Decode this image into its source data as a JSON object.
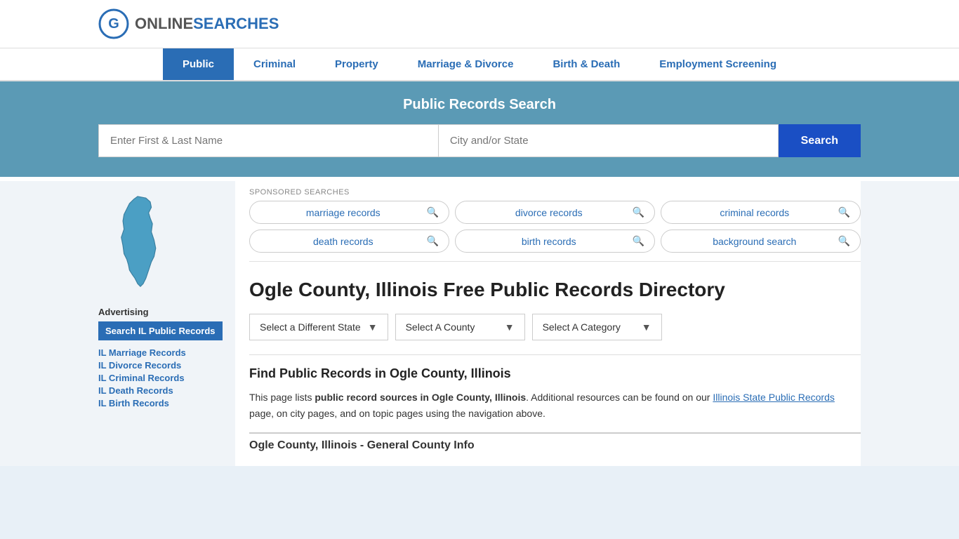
{
  "header": {
    "logo_online": "ONLINE",
    "logo_searches": "SEARCHES"
  },
  "nav": {
    "items": [
      {
        "label": "Public",
        "active": true
      },
      {
        "label": "Criminal",
        "active": false
      },
      {
        "label": "Property",
        "active": false
      },
      {
        "label": "Marriage & Divorce",
        "active": false
      },
      {
        "label": "Birth & Death",
        "active": false
      },
      {
        "label": "Employment Screening",
        "active": false
      }
    ]
  },
  "search_banner": {
    "title": "Public Records Search",
    "name_placeholder": "Enter First & Last Name",
    "location_placeholder": "City and/or State",
    "button_label": "Search"
  },
  "sponsored": {
    "label": "SPONSORED SEARCHES",
    "items": [
      {
        "text": "marriage records"
      },
      {
        "text": "divorce records"
      },
      {
        "text": "criminal records"
      },
      {
        "text": "death records"
      },
      {
        "text": "birth records"
      },
      {
        "text": "background search"
      }
    ]
  },
  "page": {
    "title": "Ogle County, Illinois Free Public Records Directory",
    "dropdowns": {
      "state": "Select a Different State",
      "county": "Select A County",
      "category": "Select A Category"
    },
    "find_title": "Find Public Records in Ogle County, Illinois",
    "find_text_1": "This page lists ",
    "find_bold": "public record sources in Ogle County, Illinois",
    "find_text_2": ". Additional resources can be found on our ",
    "find_link": "Illinois State Public Records",
    "find_text_3": " page, on city pages, and on topic pages using the navigation above.",
    "county_info_title": "Ogle County, Illinois - General County Info"
  },
  "sidebar": {
    "advertising_label": "Advertising",
    "search_btn": "Search IL Public Records",
    "links": [
      "IL Marriage Records",
      "IL Divorce Records",
      "IL Criminal Records",
      "IL Death Records",
      "IL Birth Records"
    ]
  }
}
